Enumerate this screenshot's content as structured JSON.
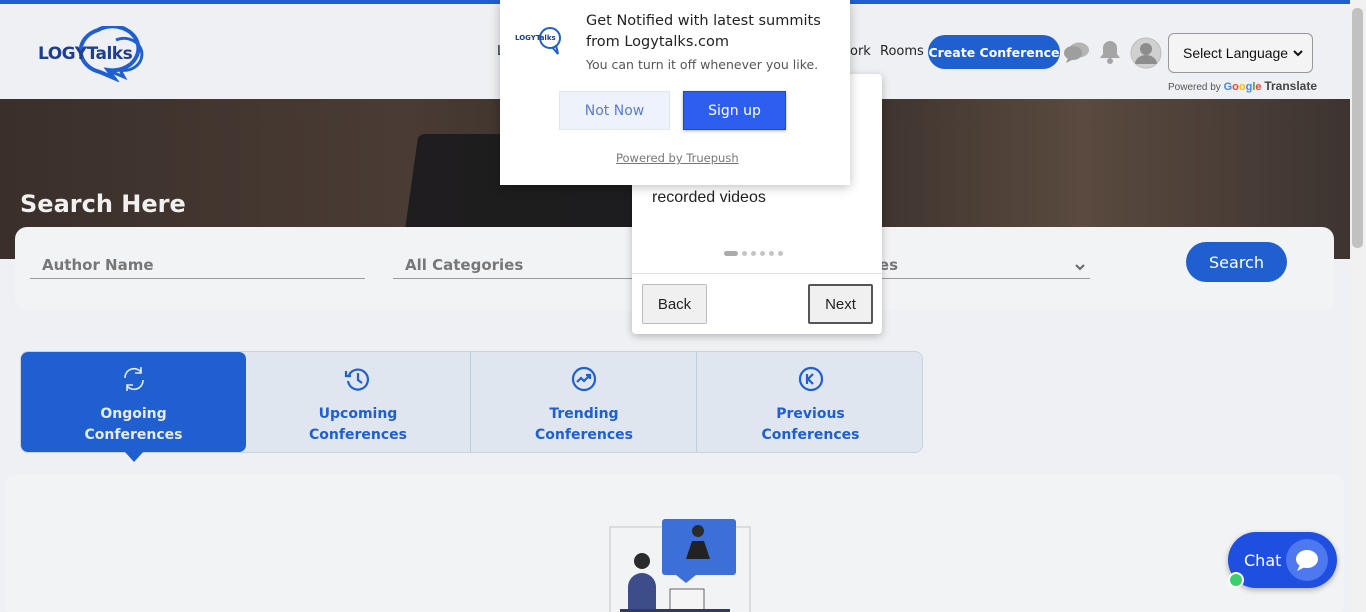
{
  "header": {
    "logo_word1": "LOGY",
    "logo_word2": "Talks",
    "nav_items": [
      "L",
      "ork",
      "Rooms"
    ],
    "create_button": "Create Conference",
    "language_select": "Select Language",
    "powered_by": "Powered by",
    "translate": "Translate",
    "google_letters": [
      "G",
      "o",
      "o",
      "g",
      "l",
      "e"
    ]
  },
  "hero": {
    "title": "Search Here"
  },
  "search": {
    "author_placeholder": "Author Name",
    "categories_placeholder": "All Categories",
    "third_placeholder_partial": "ces",
    "button": "Search"
  },
  "tabs": [
    {
      "line1": "Ongoing",
      "line2": "Conferences",
      "icon": "refresh-icon",
      "active": true
    },
    {
      "line1": "Upcoming",
      "line2": "Conferences",
      "icon": "clock-icon",
      "active": false
    },
    {
      "line1": "Trending",
      "line2": "Conferences",
      "icon": "trending-icon",
      "active": false
    },
    {
      "line1": "Previous",
      "line2": "Conferences",
      "icon": "previous-icon",
      "active": false
    }
  ],
  "tour": {
    "text": "recorded videos",
    "back": "Back",
    "next": "Next",
    "step_count": 6,
    "current_step": 1
  },
  "push": {
    "logo_word1": "LOGY",
    "logo_word2": "Talks",
    "title": "Get Notified with latest summits from Logytalks.com",
    "subtitle": "You can turn it off whenever you like.",
    "not_now": "Not Now",
    "sign_up": "Sign up",
    "powered": "Powered by Truepush"
  },
  "chat": {
    "label": "Chat"
  },
  "colors": {
    "brand_blue": "#1f5fcf",
    "push_blue": "#2d5ef0",
    "online_green": "#3ccf6b"
  }
}
